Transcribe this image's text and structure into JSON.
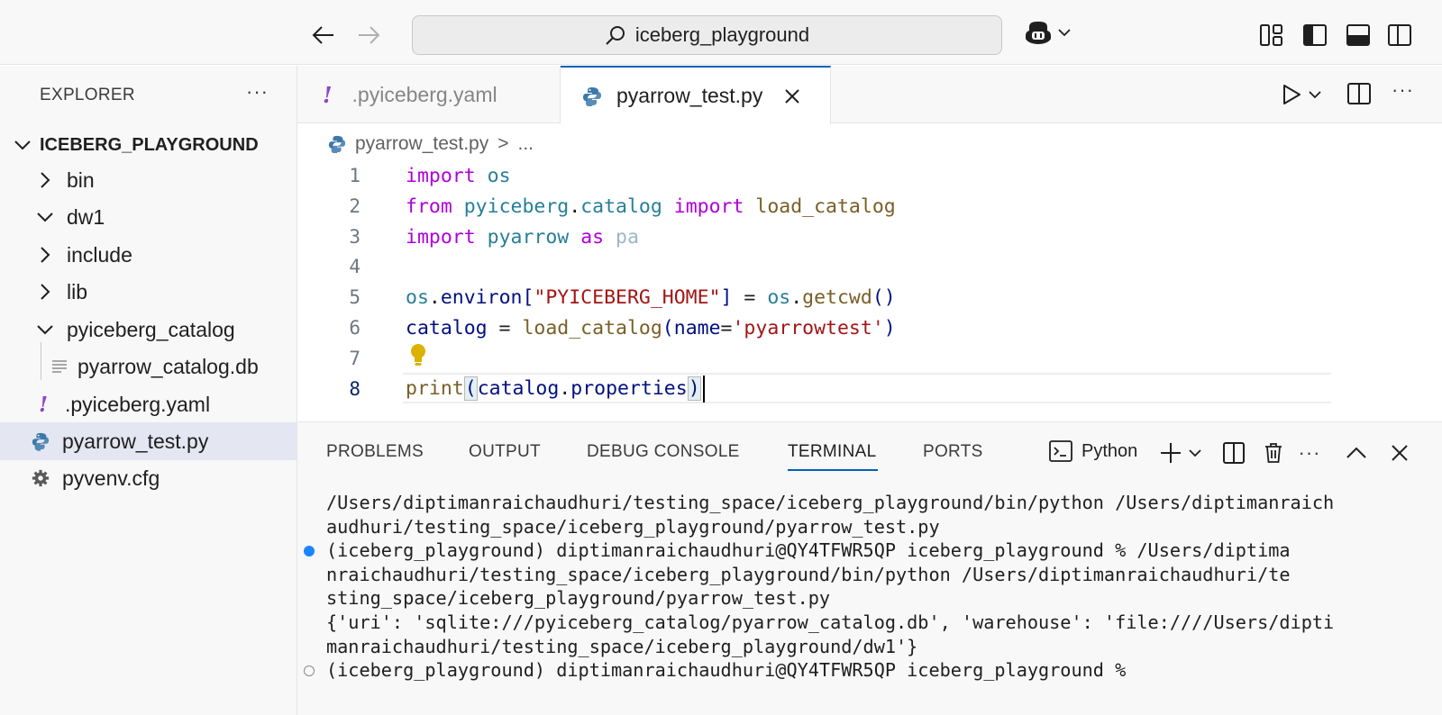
{
  "titlebar": {
    "search_text": "iceberg_playground"
  },
  "sidebar": {
    "header": "EXPLORER",
    "more": "···",
    "root_folder": "ICEBERG_PLAYGROUND",
    "items": [
      {
        "label": "bin",
        "kind": "folder",
        "expanded": false
      },
      {
        "label": "dw1",
        "kind": "folder",
        "expanded": true
      },
      {
        "label": "include",
        "kind": "folder",
        "expanded": false
      },
      {
        "label": "lib",
        "kind": "folder",
        "expanded": false
      },
      {
        "label": "pyiceberg_catalog",
        "kind": "folder",
        "expanded": true
      },
      {
        "label": "pyarrow_catalog.db",
        "kind": "file-db"
      },
      {
        "label": ".pyiceberg.yaml",
        "kind": "file-yaml"
      },
      {
        "label": "pyarrow_test.py",
        "kind": "file-python",
        "selected": true
      },
      {
        "label": "pyvenv.cfg",
        "kind": "file-config"
      }
    ]
  },
  "tabs": [
    {
      "label": ".pyiceberg.yaml",
      "icon": "yaml-icon",
      "active": false
    },
    {
      "label": "pyarrow_test.py",
      "icon": "python-icon",
      "active": true
    }
  ],
  "tab_more": "···",
  "breadcrumb": {
    "file": "pyarrow_test.py",
    "separator": ">",
    "rest": "..."
  },
  "editor": {
    "line_numbers": [
      "1",
      "2",
      "3",
      "4",
      "5",
      "6",
      "7",
      "8"
    ],
    "active_line": "8",
    "lines": {
      "l1": {
        "kw1": "import",
        "mod1": "os"
      },
      "l2": {
        "kw1": "from",
        "mod1": "pyiceberg",
        "dot": ".",
        "mod2": "catalog",
        "kw2": "import",
        "fn1": "load_catalog"
      },
      "l3": {
        "kw1": "import",
        "mod1": "pyarrow",
        "kw2": "as",
        "alias": "pa"
      },
      "l5": {
        "mod1": "os",
        "dot1": ".",
        "var1": "environ",
        "br1": "[",
        "str1": "\"PYICEBERG_HOME\"",
        "br2": "]",
        "eq": " = ",
        "mod2": "os",
        "dot2": ".",
        "fn1": "getcwd",
        "paren": "()"
      },
      "l6": {
        "var1": "catalog",
        "eq": " = ",
        "fn1": "load_catalog",
        "p1": "(",
        "var2": "name",
        "eqs": "=",
        "str1": "'pyarrowtest'",
        "p2": ")"
      },
      "l8": {
        "fn1": "print",
        "p1": "(",
        "var1": "catalog",
        "dot": ".",
        "var2": "properties",
        "p2": ")"
      }
    }
  },
  "panel": {
    "tabs": [
      "PROBLEMS",
      "OUTPUT",
      "DEBUG CONSOLE",
      "TERMINAL",
      "PORTS"
    ],
    "active_tab": "TERMINAL",
    "terminal_type": "Python",
    "more": "···",
    "terminal_lines": [
      "/Users/diptimanraichaudhuri/testing_space/iceberg_playground/bin/python /Users/diptimanraich",
      "audhuri/testing_space/iceberg_playground/pyarrow_test.py",
      "(iceberg_playground) diptimanraichaudhuri@QY4TFWR5QP iceberg_playground % /Users/diptima",
      "nraichaudhuri/testing_space/iceberg_playground/bin/python /Users/diptimanraichaudhuri/te",
      "sting_space/iceberg_playground/pyarrow_test.py",
      "{'uri': 'sqlite:///pyiceberg_catalog/pyarrow_catalog.db', 'warehouse': 'file:////Users/dipti",
      "manraichaudhuri/testing_space/iceberg_playground/dw1'}",
      "(iceberg_playground) diptimanraichaudhuri@QY4TFWR5QP iceberg_playground %"
    ]
  },
  "colors": {
    "accent": "#005fb8",
    "keyword": "#af00db",
    "module": "#267f99",
    "function": "#795e26",
    "variable": "#001080",
    "string": "#a31515",
    "selection_bg": "#e4e6f1",
    "terminal_dot": "#1a85ff"
  }
}
